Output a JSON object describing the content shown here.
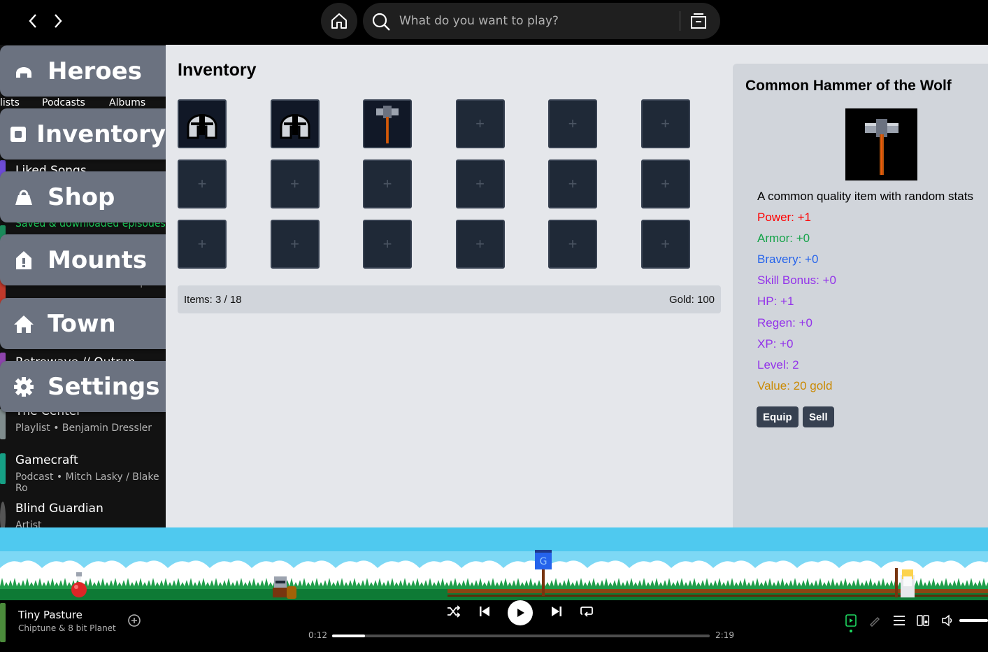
{
  "search": {
    "placeholder": "What do you want to play?"
  },
  "library": {
    "chips": [
      "lists",
      "Podcasts",
      "Albums"
    ],
    "items": [
      {
        "title": "Liked Songs",
        "subtitle": ""
      },
      {
        "title": "",
        "subtitle": "Saved & downloaded episodes"
      },
      {
        "title": "",
        "subtitle": "Podcast • Alexander Corspian"
      },
      {
        "title": "Retrowave // Outrun",
        "subtitle": ""
      },
      {
        "title": "The Center",
        "subtitle": "Playlist • Benjamin Dressler"
      },
      {
        "title": "Gamecraft",
        "subtitle": "Podcast • Mitch Lasky / Blake Ro"
      },
      {
        "title": "Blind Guardian",
        "subtitle": "Artist"
      }
    ]
  },
  "menu": [
    {
      "label": "Heroes",
      "icon": "helmet-icon"
    },
    {
      "label": "Inventory",
      "icon": "inventory-icon"
    },
    {
      "label": "Shop",
      "icon": "shop-icon"
    },
    {
      "label": "Mounts",
      "icon": "mount-icon"
    },
    {
      "label": "Town",
      "icon": "home-icon"
    },
    {
      "label": "Settings",
      "icon": "gear-icon"
    }
  ],
  "inventory": {
    "title": "Inventory",
    "slots": [
      "helmet",
      "helmet",
      "hammer",
      "",
      "",
      "",
      "",
      "",
      "",
      "",
      "",
      "",
      "",
      "",
      "",
      "",
      "",
      ""
    ],
    "empty_symbol": "+",
    "items_label": "Items: 3 / 18",
    "gold_label": "Gold: 100"
  },
  "detail": {
    "title": "Common Hammer of the Wolf",
    "description": "A common quality item with random stats",
    "stats": [
      {
        "text": "Power: +1",
        "color": "#ff0000"
      },
      {
        "text": "Armor: +0",
        "color": "#16a34a"
      },
      {
        "text": "Bravery: +0",
        "color": "#2563eb"
      },
      {
        "text": "Skill Bonus: +0",
        "color": "#9333ea"
      },
      {
        "text": "HP: +1",
        "color": "#9333ea"
      },
      {
        "text": "Regen: +0",
        "color": "#9333ea"
      },
      {
        "text": "XP: +0",
        "color": "#9333ea"
      },
      {
        "text": "Level: 2",
        "color": "#9333ea"
      },
      {
        "text": "Value: 20 gold",
        "color": "#ca8a04"
      }
    ],
    "equip_label": "Equip",
    "sell_label": "Sell"
  },
  "player": {
    "title": "Tiny Pasture",
    "artist": "Chiptune & 8 bit Planet",
    "elapsed": "0:12",
    "duration": "2:19",
    "progress": 0.087
  }
}
